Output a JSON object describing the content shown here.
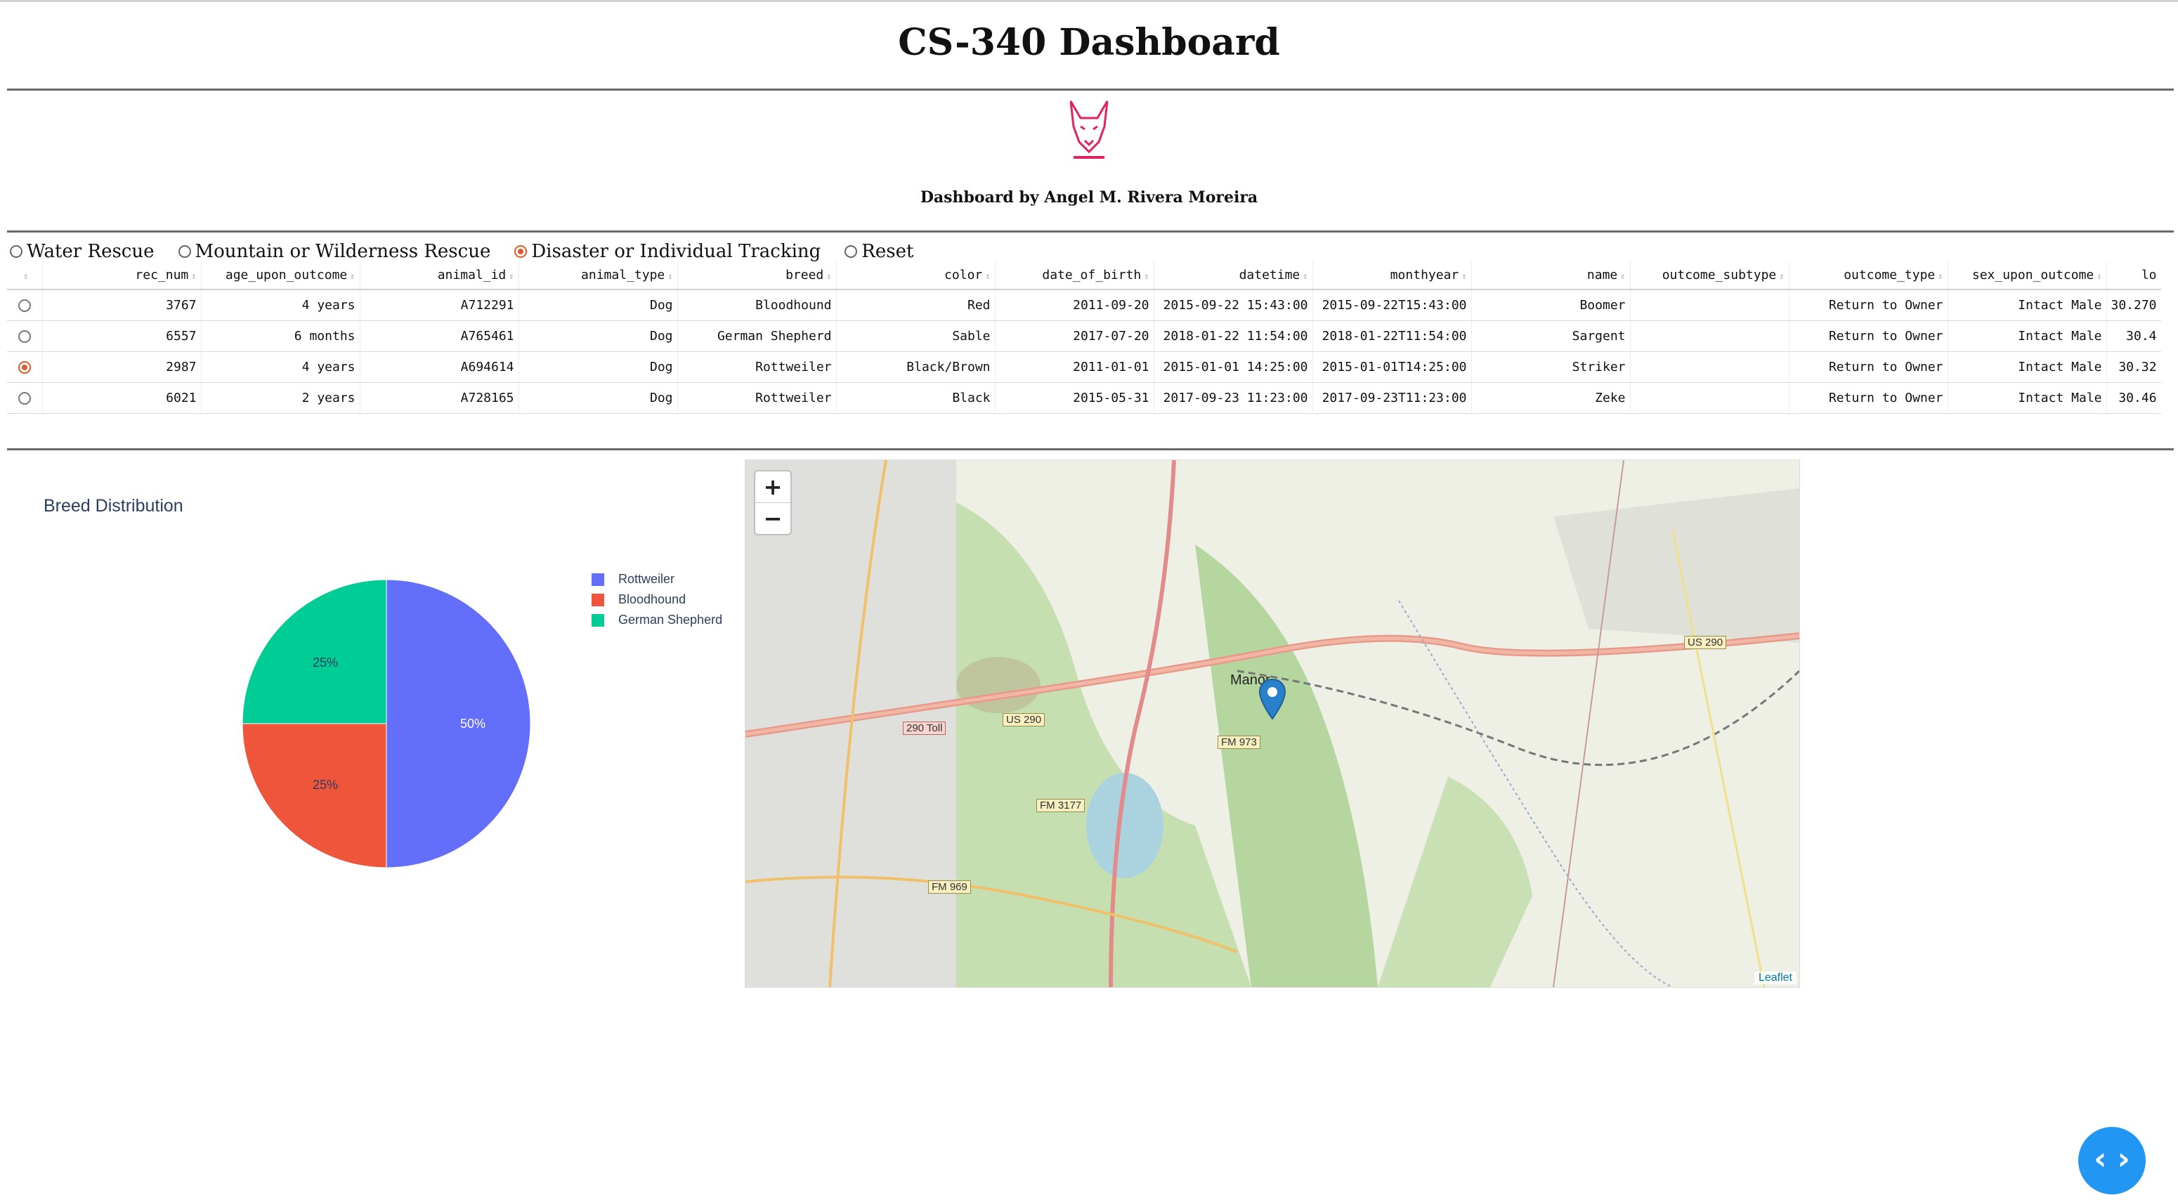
{
  "header": {
    "title": "CS-340 Dashboard",
    "byline": "Dashboard by Angel M. Rivera Moreira"
  },
  "logo": {
    "icon": "dog-head-logo",
    "color": "#e0245e"
  },
  "filters": {
    "options": [
      {
        "label": "Water Rescue",
        "selected": false
      },
      {
        "label": "Mountain or Wilderness Rescue",
        "selected": false
      },
      {
        "label": "Disaster or Individual Tracking",
        "selected": true
      },
      {
        "label": "Reset",
        "selected": false
      }
    ]
  },
  "table": {
    "columns": [
      "",
      "rec_num",
      "age_upon_outcome",
      "animal_id",
      "animal_type",
      "breed",
      "color",
      "date_of_birth",
      "datetime",
      "monthyear",
      "name",
      "outcome_subtype",
      "outcome_type",
      "sex_upon_outcome",
      "lo"
    ],
    "rows": [
      {
        "selected": false,
        "cells": [
          "3767",
          "4 years",
          "A712291",
          "Dog",
          "Bloodhound",
          "Red",
          "2011-09-20",
          "2015-09-22 15:43:00",
          "2015-09-22T15:43:00",
          "Boomer",
          "",
          "Return to Owner",
          "Intact Male",
          "30.270"
        ]
      },
      {
        "selected": false,
        "cells": [
          "6557",
          "6 months",
          "A765461",
          "Dog",
          "German Shepherd",
          "Sable",
          "2017-07-20",
          "2018-01-22 11:54:00",
          "2018-01-22T11:54:00",
          "Sargent",
          "",
          "Return to Owner",
          "Intact Male",
          "30.4"
        ]
      },
      {
        "selected": true,
        "cells": [
          "2987",
          "4 years",
          "A694614",
          "Dog",
          "Rottweiler",
          "Black/Brown",
          "2011-01-01",
          "2015-01-01 14:25:00",
          "2015-01-01T14:25:00",
          "Striker",
          "",
          "Return to Owner",
          "Intact Male",
          "30.32"
        ]
      },
      {
        "selected": false,
        "cells": [
          "6021",
          "2 years",
          "A728165",
          "Dog",
          "Rottweiler",
          "Black",
          "2015-05-31",
          "2017-09-23 11:23:00",
          "2017-09-23T11:23:00",
          "Zeke",
          "",
          "Return to Owner",
          "Intact Male",
          "30.46"
        ]
      }
    ]
  },
  "chart_data": {
    "type": "pie",
    "title": "Breed Distribution",
    "labels": [
      "Rottweiler",
      "Bloodhound",
      "German Shepherd"
    ],
    "values": [
      50,
      25,
      25
    ],
    "slice_labels": [
      "50%",
      "25%",
      "25%"
    ],
    "colors": [
      "#636efa",
      "#ef553b",
      "#00cc96"
    ],
    "legend": "right"
  },
  "map": {
    "zoom_in": "+",
    "zoom_out": "−",
    "attribution": "Leaflet",
    "place_labels": [
      "Manor"
    ],
    "road_labels": [
      "US 290",
      "290 Toll",
      "US 290",
      "FM 973",
      "FM 3177",
      "FM 969"
    ],
    "marker_icon": "map-marker-icon"
  },
  "fab": {
    "icon": "code-toggle-icon",
    "label": "‹ ›"
  }
}
